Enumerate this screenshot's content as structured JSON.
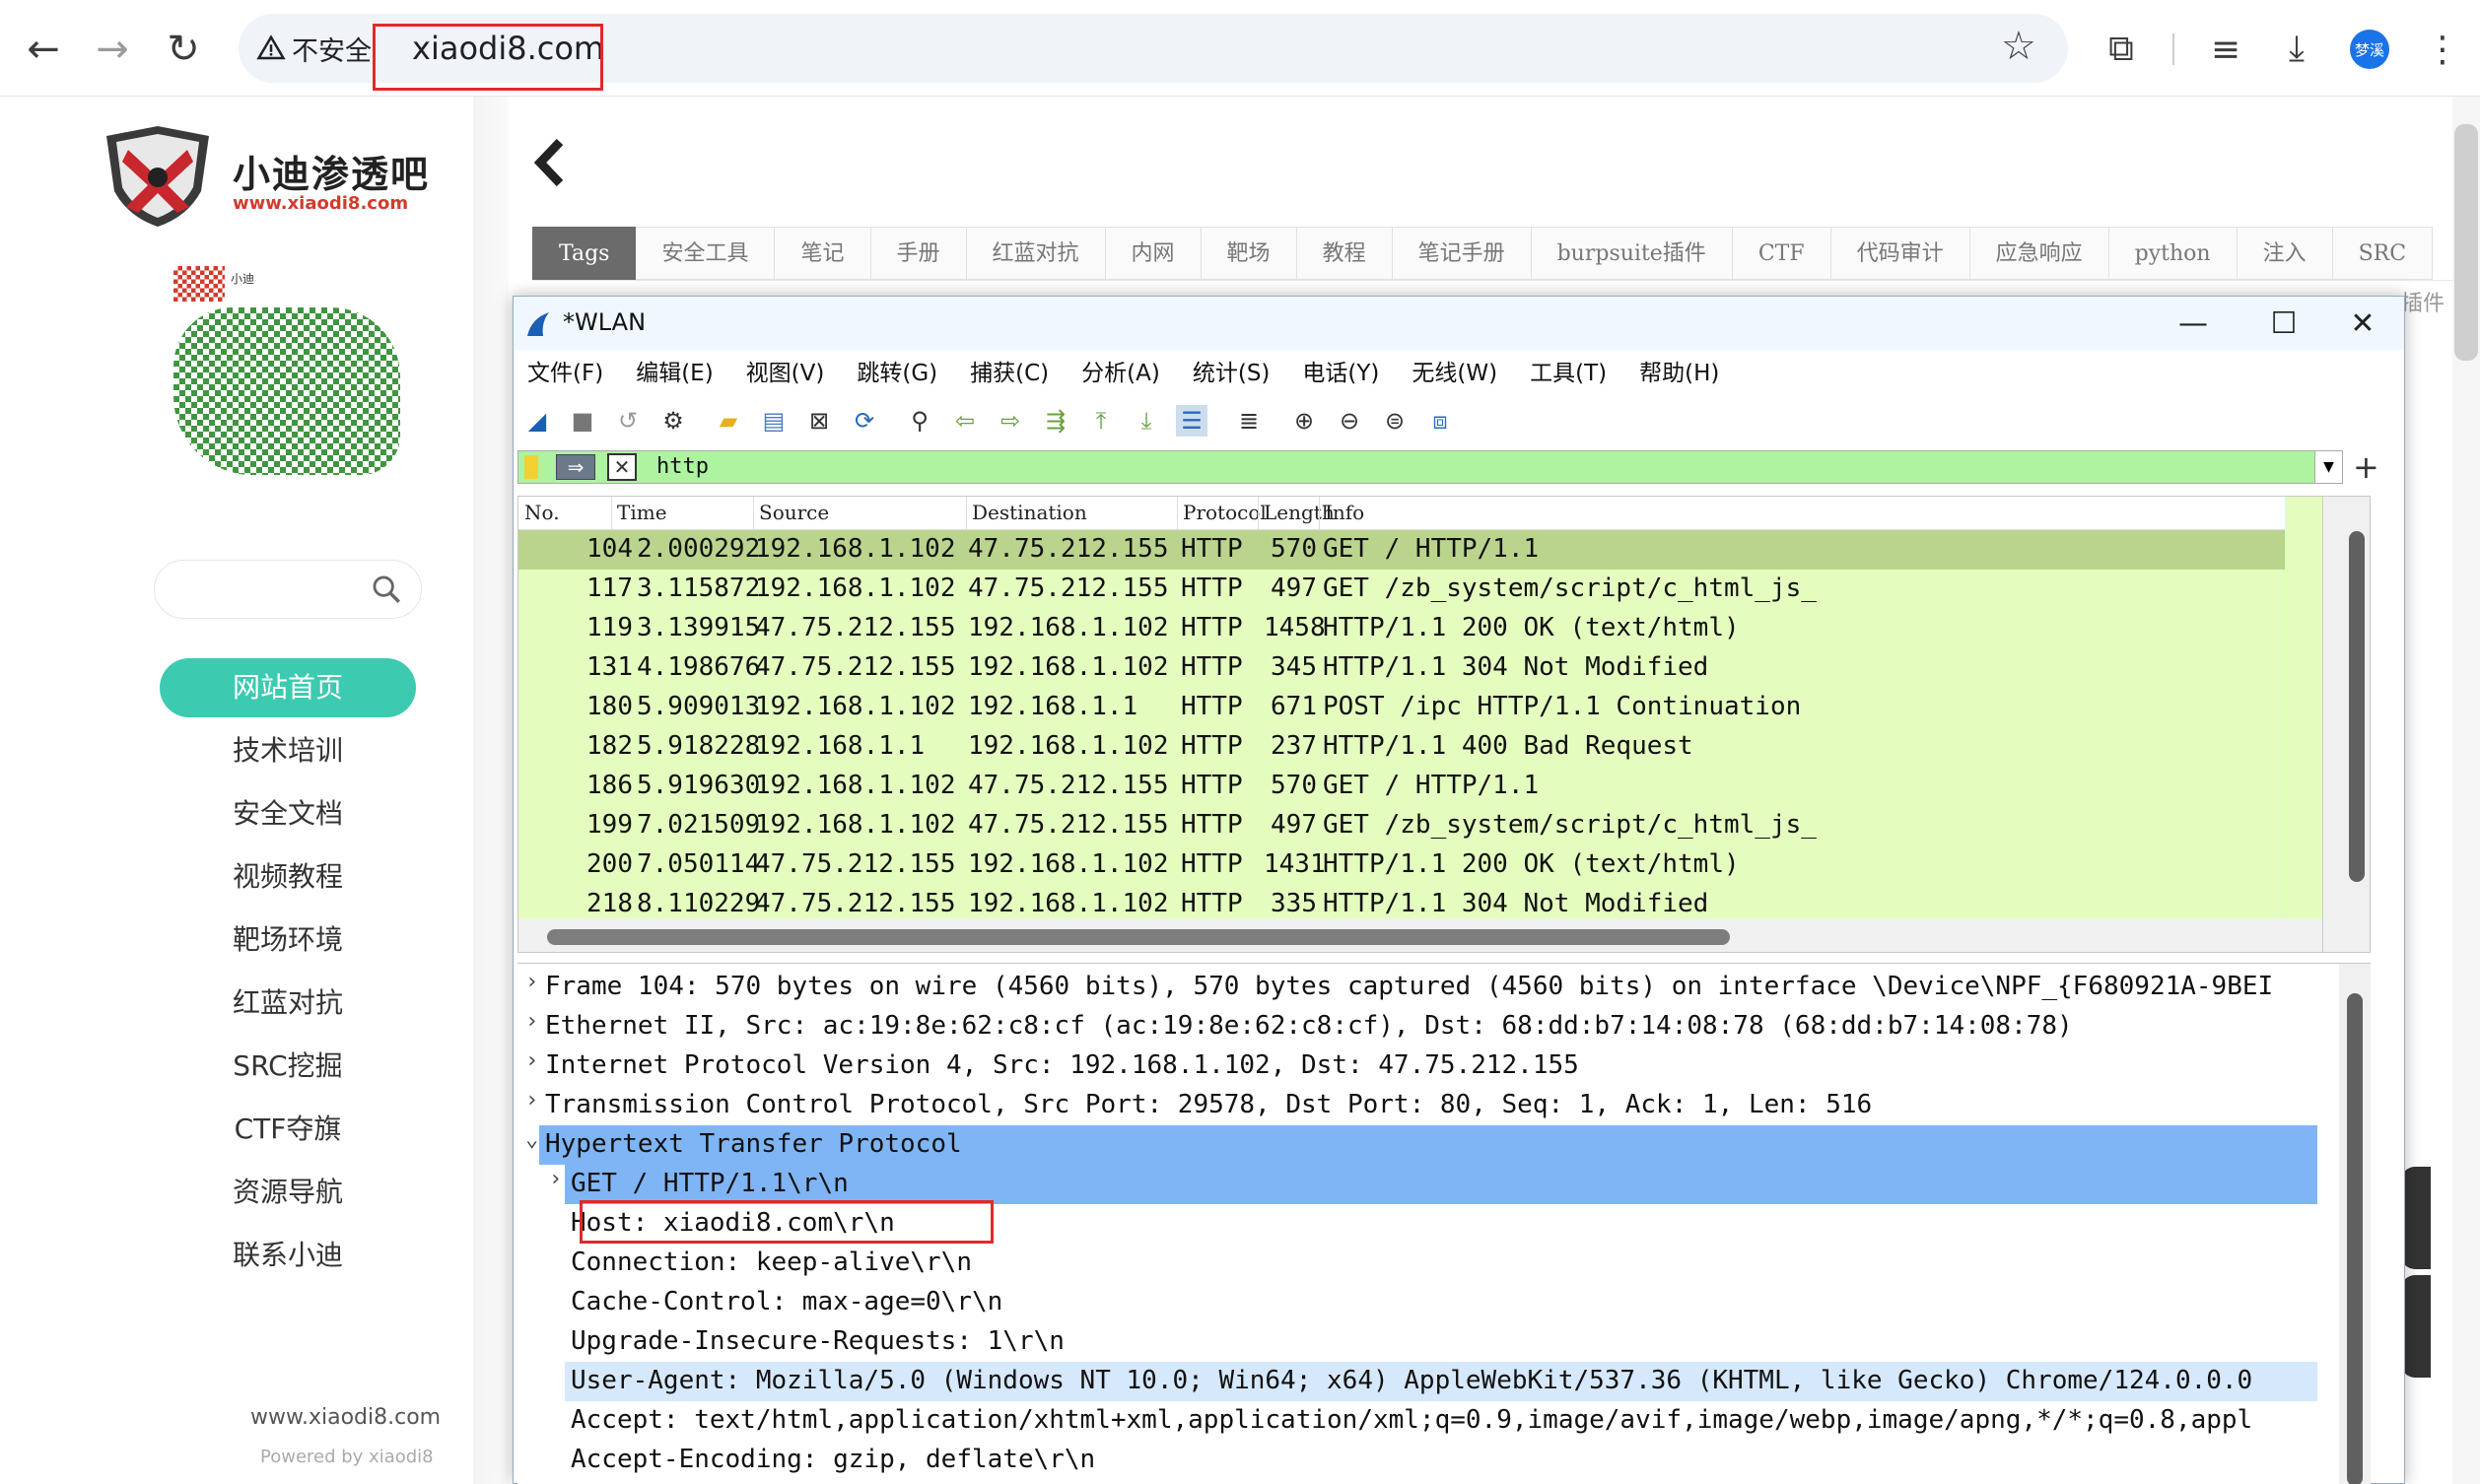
{
  "browser": {
    "security_warning": "不安全",
    "url": "xiaodi8.com",
    "avatar_text": "梦溪"
  },
  "site": {
    "logo_title": "小迪渗透吧",
    "logo_url": "www.xiaodi8.com",
    "qr_label": "小迪",
    "search_placeholder": "",
    "menu": [
      "网站首页",
      "技术培训",
      "安全文档",
      "视频教程",
      "靶场环境",
      "红蓝对抗",
      "SRC挖掘",
      "CTF夺旗",
      "资源导航",
      "联系小迪"
    ],
    "footer_domain": "www.xiaodi8.com",
    "footer_powered": "Powered by xiaodi8",
    "tags": [
      "Tags",
      "安全工具",
      "笔记",
      "手册",
      "红蓝对抗",
      "内网",
      "靶场",
      "教程",
      "笔记手册",
      "burpsuite插件",
      "CTF",
      "代码审计",
      "应急响应",
      "python",
      "注入",
      "SRC"
    ],
    "right_ghost_text": "插件"
  },
  "wireshark": {
    "title": "*WLAN",
    "menu": [
      "文件(F)",
      "编辑(E)",
      "视图(V)",
      "跳转(G)",
      "捕获(C)",
      "分析(A)",
      "统计(S)",
      "电话(Y)",
      "无线(W)",
      "工具(T)",
      "帮助(H)"
    ],
    "filter": "http",
    "columns": [
      "No.",
      "Time",
      "Source",
      "Destination",
      "Protocol",
      "Length",
      "Info"
    ],
    "packets": [
      {
        "no": "104",
        "time": "2.000292",
        "src": "192.168.1.102",
        "dst": "47.75.212.155",
        "proto": "HTTP",
        "len": "570",
        "info": "GET / HTTP/1.1"
      },
      {
        "no": "117",
        "time": "3.115872",
        "src": "192.168.1.102",
        "dst": "47.75.212.155",
        "proto": "HTTP",
        "len": "497",
        "info": "GET /zb_system/script/c_html_js_"
      },
      {
        "no": "119",
        "time": "3.139915",
        "src": "47.75.212.155",
        "dst": "192.168.1.102",
        "proto": "HTTP",
        "len": "1458",
        "info": "HTTP/1.1 200 OK  (text/html)"
      },
      {
        "no": "131",
        "time": "4.198676",
        "src": "47.75.212.155",
        "dst": "192.168.1.102",
        "proto": "HTTP",
        "len": "345",
        "info": "HTTP/1.1 304 Not Modified"
      },
      {
        "no": "180",
        "time": "5.909013",
        "src": "192.168.1.102",
        "dst": "192.168.1.1",
        "proto": "HTTP",
        "len": "671",
        "info": "POST /ipc HTTP/1.1 Continuation"
      },
      {
        "no": "182",
        "time": "5.918228",
        "src": "192.168.1.1",
        "dst": "192.168.1.102",
        "proto": "HTTP",
        "len": "237",
        "info": "HTTP/1.1 400 Bad Request"
      },
      {
        "no": "186",
        "time": "5.919630",
        "src": "192.168.1.102",
        "dst": "47.75.212.155",
        "proto": "HTTP",
        "len": "570",
        "info": "GET / HTTP/1.1"
      },
      {
        "no": "199",
        "time": "7.021509",
        "src": "192.168.1.102",
        "dst": "47.75.212.155",
        "proto": "HTTP",
        "len": "497",
        "info": "GET /zb_system/script/c_html_js_"
      },
      {
        "no": "200",
        "time": "7.050114",
        "src": "47.75.212.155",
        "dst": "192.168.1.102",
        "proto": "HTTP",
        "len": "1431",
        "info": "HTTP/1.1 200 OK  (text/html)"
      },
      {
        "no": "218",
        "time": "8.110229",
        "src": "47.75.212.155",
        "dst": "192.168.1.102",
        "proto": "HTTP",
        "len": "335",
        "info": "HTTP/1.1 304 Not Modified"
      }
    ],
    "details": [
      {
        "caret": ">",
        "indent": 0,
        "text": "Frame 104: 570 bytes on wire (4560 bits), 570 bytes captured (4560 bits) on interface \\Device\\NPF_{F680921A-9BEI",
        "style": ""
      },
      {
        "caret": ">",
        "indent": 0,
        "text": "Ethernet II, Src: ac:19:8e:62:c8:cf (ac:19:8e:62:c8:cf), Dst: 68:dd:b7:14:08:78 (68:dd:b7:14:08:78)",
        "style": ""
      },
      {
        "caret": ">",
        "indent": 0,
        "text": "Internet Protocol Version 4, Src: 192.168.1.102, Dst: 47.75.212.155",
        "style": ""
      },
      {
        "caret": ">",
        "indent": 0,
        "text": "Transmission Control Protocol, Src Port: 29578, Dst Port: 80, Seq: 1, Ack: 1, Len: 516",
        "style": ""
      },
      {
        "caret": "v",
        "indent": 0,
        "text": "Hypertext Transfer Protocol",
        "style": "sel"
      },
      {
        "caret": ">",
        "indent": 1,
        "text": "GET / HTTP/1.1\\r\\n",
        "style": "sel"
      },
      {
        "caret": "",
        "indent": 1,
        "text": "Host: xiaodi8.com\\r\\n",
        "style": ""
      },
      {
        "caret": "",
        "indent": 1,
        "text": "Connection: keep-alive\\r\\n",
        "style": ""
      },
      {
        "caret": "",
        "indent": 1,
        "text": "Cache-Control: max-age=0\\r\\n",
        "style": ""
      },
      {
        "caret": "",
        "indent": 1,
        "text": "Upgrade-Insecure-Requests: 1\\r\\n",
        "style": ""
      },
      {
        "caret": "",
        "indent": 1,
        "text": "User-Agent: Mozilla/5.0 (Windows NT 10.0; Win64; x64) AppleWebKit/537.36 (KHTML, like Gecko) Chrome/124.0.0.0",
        "style": "ua"
      },
      {
        "caret": "",
        "indent": 1,
        "text": "Accept: text/html,application/xhtml+xml,application/xml;q=0.9,image/avif,image/webp,image/apng,*/*;q=0.8,appl",
        "style": ""
      },
      {
        "caret": "",
        "indent": 1,
        "text": "Accept-Encoding: gzip, deflate\\r\\n",
        "style": ""
      }
    ]
  }
}
